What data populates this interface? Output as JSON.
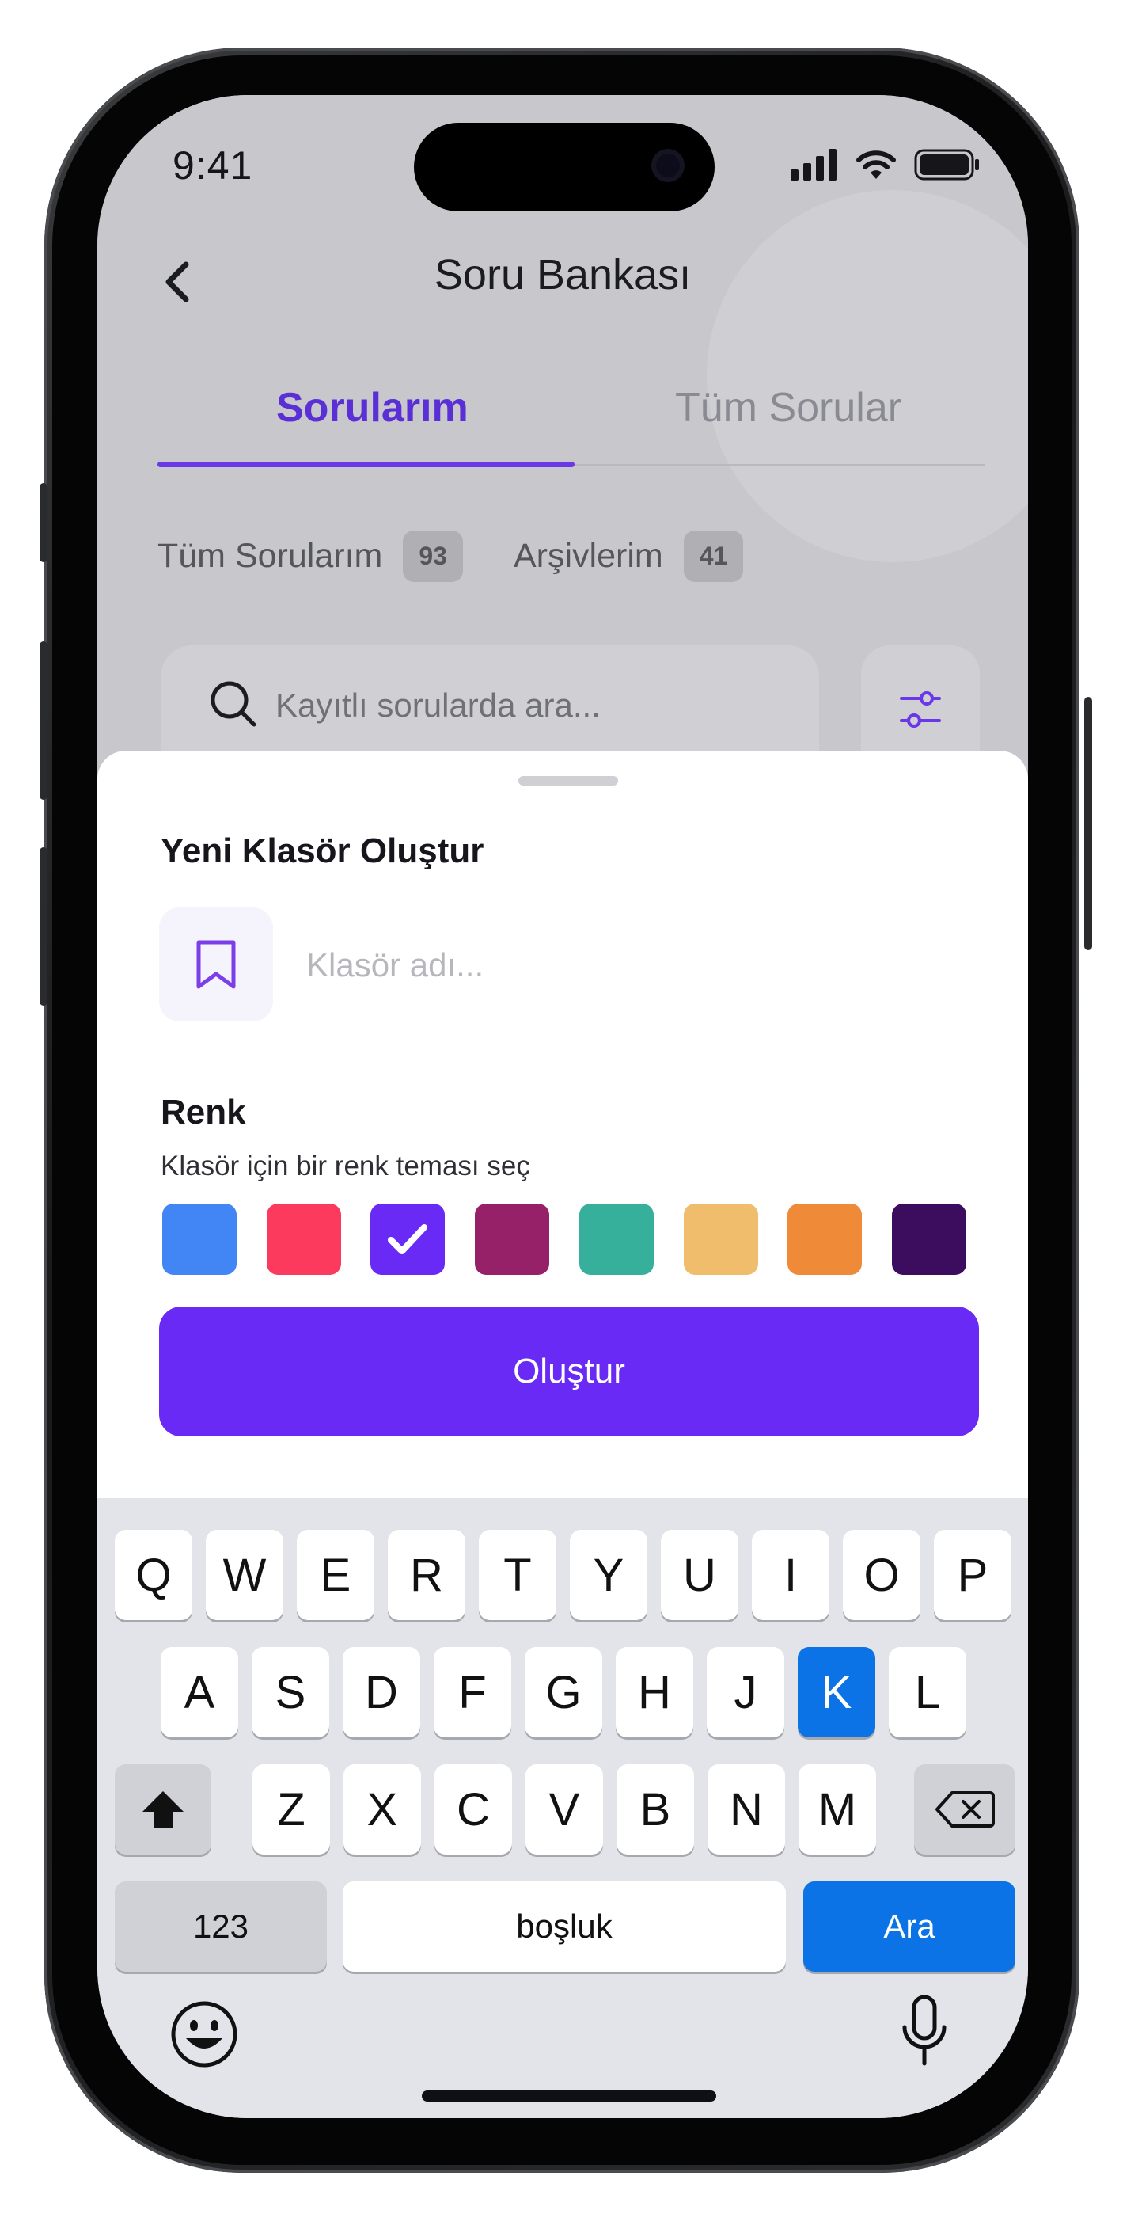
{
  "status_bar": {
    "time": "9:41"
  },
  "nav": {
    "title": "Soru Bankası"
  },
  "tabs": [
    {
      "label": "Sorularım",
      "active": true
    },
    {
      "label": "Tüm Sorular",
      "active": false
    }
  ],
  "filters": [
    {
      "label": "Tüm Sorularım",
      "count": "93"
    },
    {
      "label": "Arşivlerim",
      "count": "41"
    }
  ],
  "search": {
    "placeholder": "Kayıtlı sorularda ara..."
  },
  "sheet": {
    "title": "Yeni Klasör Oluştur",
    "folder_placeholder": "Klasör adı...",
    "color_title": "Renk",
    "color_subtitle": "Klasör için bir renk teması seç",
    "colors": [
      "#4285f4",
      "#fb3a5e",
      "#6a2af6",
      "#972169",
      "#37b09b",
      "#f0bd6c",
      "#ef8a38",
      "#3c0d5e"
    ],
    "selected_color_index": 2,
    "create_label": "Oluştur"
  },
  "keyboard": {
    "row1": [
      "Q",
      "W",
      "E",
      "R",
      "T",
      "Y",
      "U",
      "I",
      "O",
      "P"
    ],
    "row2": [
      "A",
      "S",
      "D",
      "F",
      "G",
      "H",
      "J",
      "K",
      "L"
    ],
    "row3": [
      "Z",
      "X",
      "C",
      "V",
      "B",
      "N",
      "M"
    ],
    "highlighted_key": "K",
    "numbers_label": "123",
    "space_label": "boşluk",
    "action_label": "Ara",
    "accent": "#0b73e5"
  },
  "icons": {
    "back": "chevron-left-icon",
    "search": "search-icon",
    "filter": "sliders-icon",
    "folder": "bookmark-icon",
    "check": "check-icon",
    "shift": "shift-icon",
    "delete": "backspace-icon",
    "emoji": "emoji-icon",
    "mic": "microphone-icon"
  }
}
